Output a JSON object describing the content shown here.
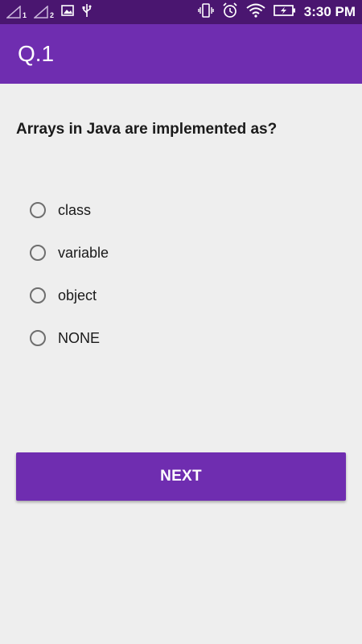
{
  "status_bar": {
    "time": "3:30 PM",
    "sim1_label": "1",
    "sim2_label": "2",
    "icons": [
      "signal-sim1-icon",
      "signal-sim2-icon",
      "image-icon",
      "usb-icon",
      "vibrate-icon",
      "alarm-icon",
      "wifi-icon",
      "battery-charging-icon"
    ]
  },
  "app_bar": {
    "title": "Q.1"
  },
  "question": {
    "text": "Arrays in Java are implemented as?"
  },
  "options": [
    {
      "label": "class",
      "selected": false
    },
    {
      "label": "variable",
      "selected": false
    },
    {
      "label": "object",
      "selected": false
    },
    {
      "label": "NONE",
      "selected": false
    }
  ],
  "next_button": {
    "label": "NEXT"
  },
  "colors": {
    "status_bar": "#4a1670",
    "primary": "#6f2db0",
    "background": "#eeeeee",
    "radio_border": "#6e6e6e"
  }
}
